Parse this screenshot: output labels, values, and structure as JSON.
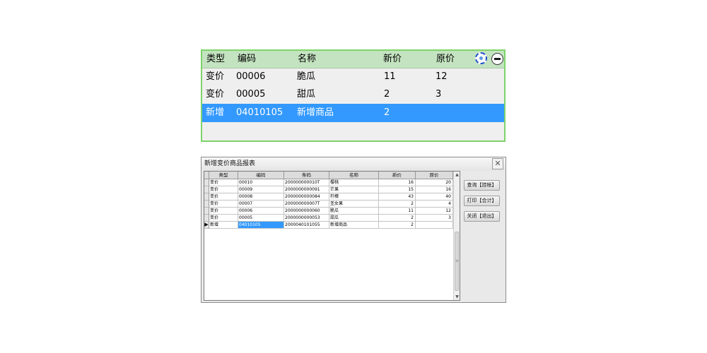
{
  "top_panel": {
    "headers": [
      "类型",
      "编码",
      "名称",
      "新价",
      "原价"
    ],
    "rows": [
      {
        "type": "变价",
        "code": "00006",
        "name": "脆瓜",
        "new_price": "11",
        "old_price": "12"
      },
      {
        "type": "变价",
        "code": "00005",
        "name": "甜瓜",
        "new_price": "2",
        "old_price": "3"
      },
      {
        "type": "新增",
        "code": "04010105",
        "name": "新增商品",
        "new_price": "2",
        "old_price": ""
      }
    ],
    "icons": [
      "gear-icon",
      "minus-circle-icon"
    ],
    "colors": {
      "header_bg": "#c4e3c0",
      "border": "#7dd36a",
      "selection": "#3399ff"
    }
  },
  "dialog": {
    "title": "新增变价商品报表",
    "close_glyph": "✕",
    "headers": [
      "类型",
      "编码",
      "条码",
      "名称",
      "新价",
      "原价"
    ],
    "rows": [
      {
        "type": "变价",
        "code": "00010",
        "barcode": "200000000010T",
        "name": "樱桃",
        "new_price": "16",
        "old_price": "20"
      },
      {
        "type": "变价",
        "code": "00009",
        "barcode": "2000000000091",
        "name": "芒果",
        "new_price": "15",
        "old_price": "16"
      },
      {
        "type": "变价",
        "code": "00008",
        "barcode": "2000000000084",
        "name": "柠檬",
        "new_price": "43",
        "old_price": "40"
      },
      {
        "type": "变价",
        "code": "00007",
        "barcode": "200000000007T",
        "name": "圣女果",
        "new_price": "2",
        "old_price": "4"
      },
      {
        "type": "变价",
        "code": "00006",
        "barcode": "2000000000060",
        "name": "脆瓜",
        "new_price": "11",
        "old_price": "12"
      },
      {
        "type": "变价",
        "code": "00005",
        "barcode": "2000000000053",
        "name": "甜瓜",
        "new_price": "2",
        "old_price": "3"
      },
      {
        "type": "新增",
        "code": "04010105",
        "barcode": "2000040101055",
        "name": "新增商品",
        "new_price": "2",
        "old_price": ""
      }
    ],
    "current_row_marker": "▶",
    "scroll_up": "▲",
    "scroll_down": "▼",
    "scroll_grip": "≡",
    "buttons": {
      "query": "查询【挂帐】",
      "print": "打印【合计】",
      "close": "关闭【退出】"
    }
  }
}
